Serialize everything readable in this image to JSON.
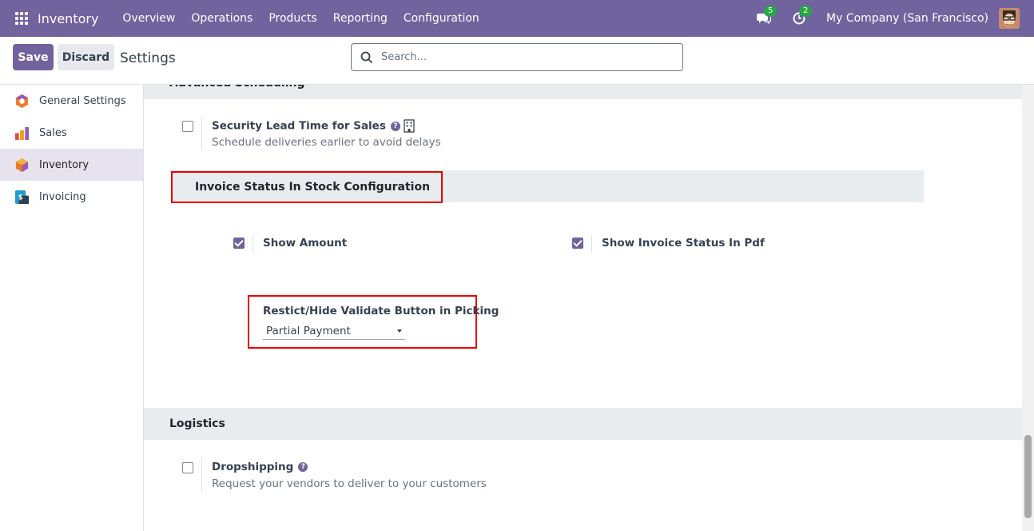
{
  "navbar": {
    "brand": "Inventory",
    "menu": [
      "Overview",
      "Operations",
      "Products",
      "Reporting",
      "Configuration"
    ],
    "messages_count": "5",
    "activities_count": "2",
    "company": "My Company (San Francisco)"
  },
  "control_panel": {
    "save_label": "Save",
    "discard_label": "Discard",
    "breadcrumb": "Settings",
    "search_placeholder": "Search..."
  },
  "sidebar": {
    "items": [
      {
        "label": "General Settings",
        "icon": "general-settings-icon",
        "active": false
      },
      {
        "label": "Sales",
        "icon": "sales-app-icon",
        "active": false
      },
      {
        "label": "Inventory",
        "icon": "inventory-app-icon",
        "active": true
      },
      {
        "label": "Invoicing",
        "icon": "invoicing-app-icon",
        "active": false
      }
    ]
  },
  "main": {
    "cut_section_title": "Advanced Scheduling",
    "security_lead": {
      "title": "Security Lead Time for Sales",
      "description": "Schedule deliveries earlier to avoid delays",
      "checked": false
    },
    "invoice_status_section": {
      "title": "Invoice Status In Stock Configuration",
      "show_amount": {
        "label": "Show Amount",
        "checked": true
      },
      "show_invoice_pdf": {
        "label": "Show Invoice Status In Pdf",
        "checked": true
      },
      "restrict_field": {
        "label": "Restict/Hide Validate Button in Picking",
        "value": "Partial Payment"
      }
    },
    "logistics": {
      "title": "Logistics",
      "dropshipping": {
        "title": "Dropshipping",
        "description": "Request your vendors to deliver to your customers",
        "checked": false
      }
    }
  },
  "colors": {
    "brand": "#71639e",
    "highlight_border": "#e00000",
    "badge": "#28a745"
  }
}
